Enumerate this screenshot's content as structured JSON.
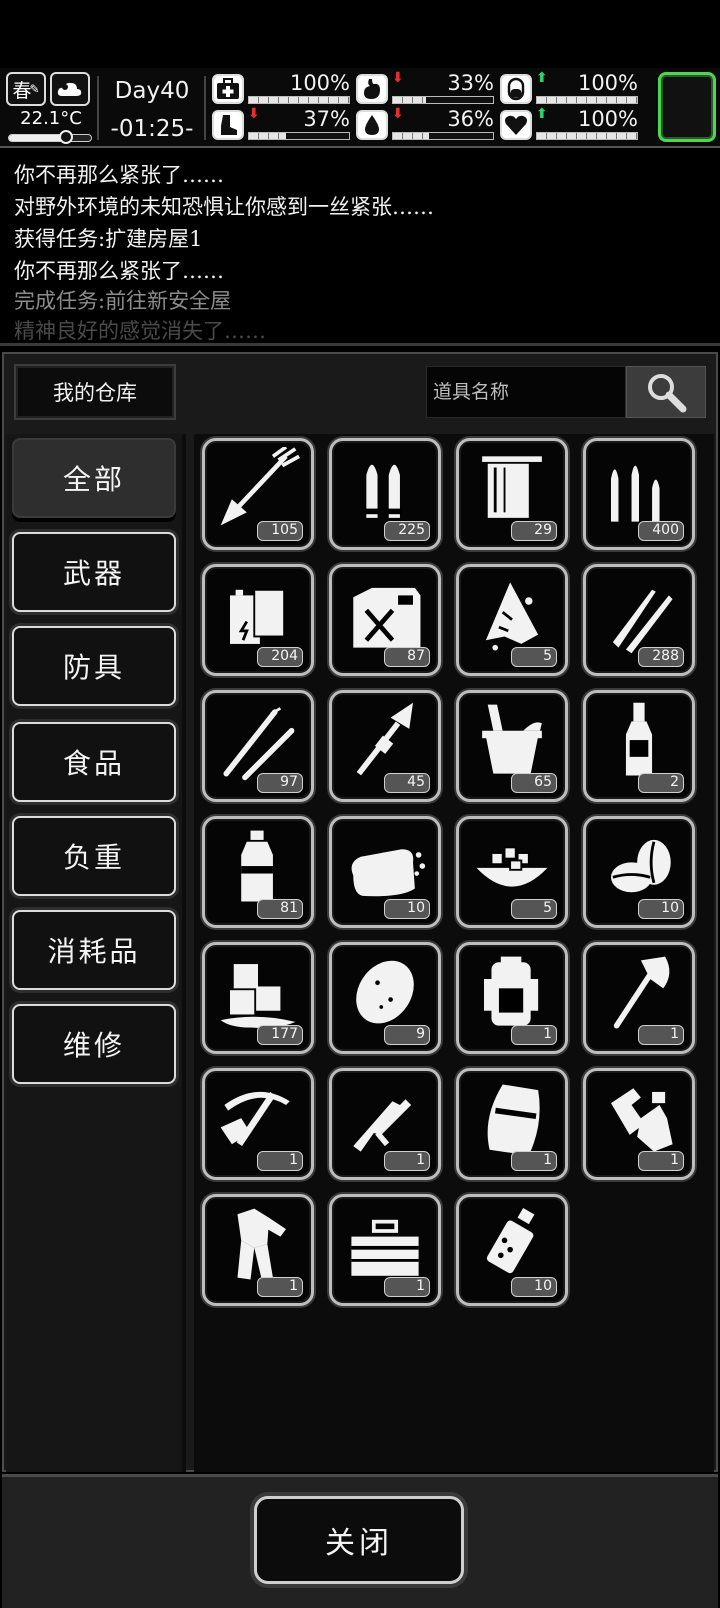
{
  "status": {
    "season": "春",
    "temperature": "22.1°C",
    "temperature_level": 0.7,
    "day": "Day40",
    "time": "-01:25-",
    "stats": [
      {
        "name": "health",
        "icon": "medkit-icon",
        "value": "100%",
        "level": 1.0,
        "trend": "none"
      },
      {
        "name": "stomach",
        "icon": "stomach-icon",
        "value": "33%",
        "level": 0.33,
        "trend": "down"
      },
      {
        "name": "energy",
        "icon": "pill-icon",
        "value": "100%",
        "level": 1.0,
        "trend": "up"
      },
      {
        "name": "stamina",
        "icon": "boot-icon",
        "value": "37%",
        "level": 0.37,
        "trend": "down"
      },
      {
        "name": "water",
        "icon": "water-drop-icon",
        "value": "36%",
        "level": 0.36,
        "trend": "down"
      },
      {
        "name": "mood",
        "icon": "heart-icon",
        "value": "100%",
        "level": 1.0,
        "trend": "up"
      }
    ],
    "colors": {
      "trend_down": "#e53030",
      "trend_up": "#2fd36a",
      "slot_border": "#4fd64f"
    }
  },
  "log": [
    {
      "text": "你不再那么紧张了……",
      "color": "#f2f2f2"
    },
    {
      "text": "对野外环境的未知恐惧让你感到一丝紧张……",
      "color": "#f2f2f2"
    },
    {
      "text": "获得任务:扩建房屋1",
      "color": "#f2f2f2"
    },
    {
      "text": "你不再那么紧张了……",
      "color": "#f2f2f2"
    },
    {
      "text": "完成任务:前往新安全屋",
      "color": "#8c8c8c"
    },
    {
      "text": "精神良好的感觉消失了……",
      "color": "#4a4a4a"
    }
  ],
  "warehouse": {
    "title": "我的仓库",
    "search_placeholder": "道具名称"
  },
  "categories": [
    "全部",
    "武器",
    "防具",
    "食品",
    "负重",
    "消耗品",
    "维修"
  ],
  "active_category": 0,
  "items": [
    {
      "icon": "arrow-icon",
      "count": "105"
    },
    {
      "icon": "bullets-icon",
      "count": "225"
    },
    {
      "icon": "towel-icon",
      "count": "29"
    },
    {
      "icon": "rifle-ammo-icon",
      "count": "400"
    },
    {
      "icon": "battery-icon",
      "count": "204"
    },
    {
      "icon": "fuel-can-icon",
      "count": "87"
    },
    {
      "icon": "rag-icon",
      "count": "5"
    },
    {
      "icon": "sniper-ammo-icon",
      "count": "288"
    },
    {
      "icon": "lockpick-icon",
      "count": "97"
    },
    {
      "icon": "rocket-icon",
      "count": "45"
    },
    {
      "icon": "bucket-icon",
      "count": "65"
    },
    {
      "icon": "liquor-bottle-icon",
      "count": "2"
    },
    {
      "icon": "water-bottle-icon",
      "count": "81"
    },
    {
      "icon": "bread-icon",
      "count": "10"
    },
    {
      "icon": "sugar-bowl-icon",
      "count": "5"
    },
    {
      "icon": "coffee-beans-icon",
      "count": "10"
    },
    {
      "icon": "ice-icon",
      "count": "177"
    },
    {
      "icon": "potato-icon",
      "count": "9"
    },
    {
      "icon": "backpack-icon",
      "count": "1"
    },
    {
      "icon": "axe-icon",
      "count": "1"
    },
    {
      "icon": "crossbow-icon",
      "count": "1"
    },
    {
      "icon": "submachine-gun-icon",
      "count": "1"
    },
    {
      "icon": "riot-shield-icon",
      "count": "1"
    },
    {
      "icon": "gloves-icon",
      "count": "1"
    },
    {
      "icon": "clothes-icon",
      "count": "1"
    },
    {
      "icon": "toolbox-icon",
      "count": "1"
    },
    {
      "icon": "grenade-icon",
      "count": "10"
    }
  ],
  "close_label": "关闭"
}
